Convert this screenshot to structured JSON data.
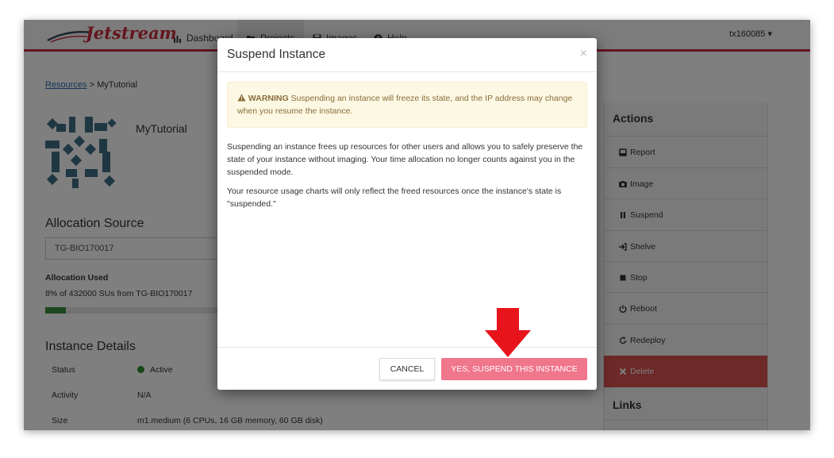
{
  "navbar": {
    "logo_text": "Jetstream",
    "items": [
      {
        "label": "Dashboard",
        "icon": "bar-chart-icon"
      },
      {
        "label": "Projects",
        "icon": "folder-open-icon"
      },
      {
        "label": "Images",
        "icon": "floppy-disk-icon"
      },
      {
        "label": "Help",
        "icon": "question-circle-icon"
      }
    ],
    "user": "tx160085 ▾"
  },
  "breadcrumb": {
    "link": "Resources",
    "separator": " > ",
    "current": "MyTutorial"
  },
  "instance": {
    "name": "MyTutorial"
  },
  "allocation": {
    "title": "Allocation Source",
    "selected": "TG-BIO170017",
    "used_label": "Allocation Used",
    "used_text": "8% of 432000 SUs from TG-BIO170017",
    "used_fraction": 0.08
  },
  "details": {
    "title": "Instance Details",
    "rows": [
      {
        "label": "Status",
        "value": "Active"
      },
      {
        "label": "Activity",
        "value": "N/A"
      },
      {
        "label": "Size",
        "value": "m1.medium (6 CPUs, 16 GB memory, 60 GB disk)"
      }
    ]
  },
  "actions": {
    "title": "Actions",
    "items": [
      {
        "label": "Report",
        "icon": "report-icon"
      },
      {
        "label": "Image",
        "icon": "camera-icon"
      },
      {
        "label": "Suspend",
        "icon": "pause-icon"
      },
      {
        "label": "Shelve",
        "icon": "sign-in-icon"
      },
      {
        "label": "Stop",
        "icon": "stop-icon"
      },
      {
        "label": "Reboot",
        "icon": "power-icon"
      },
      {
        "label": "Redeploy",
        "icon": "refresh-icon"
      },
      {
        "label": "Delete",
        "icon": "close-icon"
      }
    ],
    "links_title": "Links"
  },
  "modal": {
    "title": "Suspend Instance",
    "close": "×",
    "warning_label": "WARNING",
    "warning_text": " Suspending an instance will freeze its state, and the IP address may change when you resume the instance.",
    "paragraph1": "Suspending an instance frees up resources for other users and allows you to safely preserve the state of your instance without imaging. Your time allocation no longer counts against you in the suspended mode.",
    "paragraph2": "Your resource usage charts will only reflect the freed resources once the instance's state is \"suspended.\"",
    "cancel_label": "CANCEL",
    "confirm_label": "YES, SUSPEND THIS INSTANCE"
  },
  "colors": {
    "brand_red": "#c72b3a",
    "danger": "#d9534f",
    "confirm_button": "#f0768c",
    "annotation_arrow": "#e8141c"
  }
}
